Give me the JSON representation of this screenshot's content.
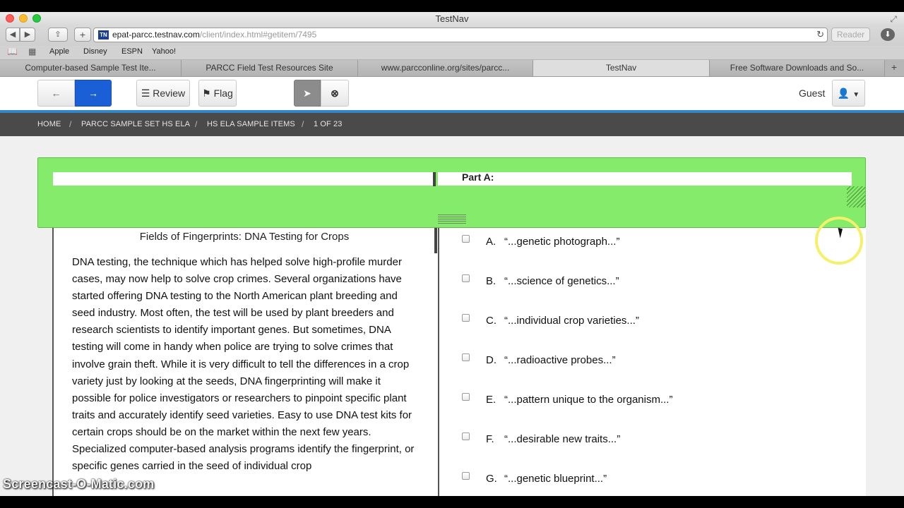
{
  "window": {
    "title": "TestNav"
  },
  "toolbar": {
    "url_host": "epat-parcc.testnav.com",
    "url_path": "/client/index.html#getitem/7495",
    "favicon_text": "TN",
    "reader_label": "Reader"
  },
  "bookmarks": [
    "Apple",
    "Disney",
    "ESPN",
    "Yahoo!"
  ],
  "tabs": [
    {
      "label": "Computer-based Sample Test Ite..."
    },
    {
      "label": "PARCC Field Test Resources Site"
    },
    {
      "label": "www.parcconline.org/sites/parcc..."
    },
    {
      "label": "TestNav"
    },
    {
      "label": "Free Software Downloads and So..."
    }
  ],
  "app": {
    "review_label": "Review",
    "flag_label": "Flag",
    "guest_label": "Guest"
  },
  "breadcrumb": [
    "HOME",
    "PARCC SAMPLE SET HS ELA",
    "HS ELA SAMPLE ITEMS",
    "1 OF 23"
  ],
  "question": {
    "part_label": "Part A:"
  },
  "passage": {
    "title": "Fields of Fingerprints: DNA Testing for Crops",
    "body": "DNA testing, the technique which has helped solve high-profile murder cases, may now help to solve crop crimes. Several organizations have started offering DNA testing to the North American plant breeding and seed industry. Most often, the test will be used by plant breeders and research scientists to identify important genes. But sometimes, DNA testing will come in handy when police are trying to solve crimes that involve grain theft. While it is very difficult to tell the differences in a crop variety just by looking at the seeds, DNA fingerprinting will make it possible for police investigators or researchers to pinpoint specific plant traits and accurately identify seed varieties. Easy to use DNA test kits for certain crops should be on the market within the next few years. Specialized computer-based analysis programs identify the fingerprint, or specific genes carried in the seed of individual crop"
  },
  "options": [
    {
      "letter": "A.",
      "text": "“...genetic photograph...”"
    },
    {
      "letter": "B.",
      "text": "“...science of genetics...”"
    },
    {
      "letter": "C.",
      "text": "“...individual crop varieties...”"
    },
    {
      "letter": "D.",
      "text": "“...radioactive probes...”"
    },
    {
      "letter": "E.",
      "text": "“...pattern unique to the organism...”"
    },
    {
      "letter": "F.",
      "text": "“...desirable new traits...”"
    },
    {
      "letter": "G.",
      "text": "“...genetic blueprint...”"
    }
  ],
  "watermark": "Screencast-O-Matic.com",
  "colors": {
    "accent_blue": "#3386c8",
    "next_button": "#1b5fd6",
    "banner_green": "#85eb6a",
    "breadcrumb_bg": "#4a4a4a"
  }
}
